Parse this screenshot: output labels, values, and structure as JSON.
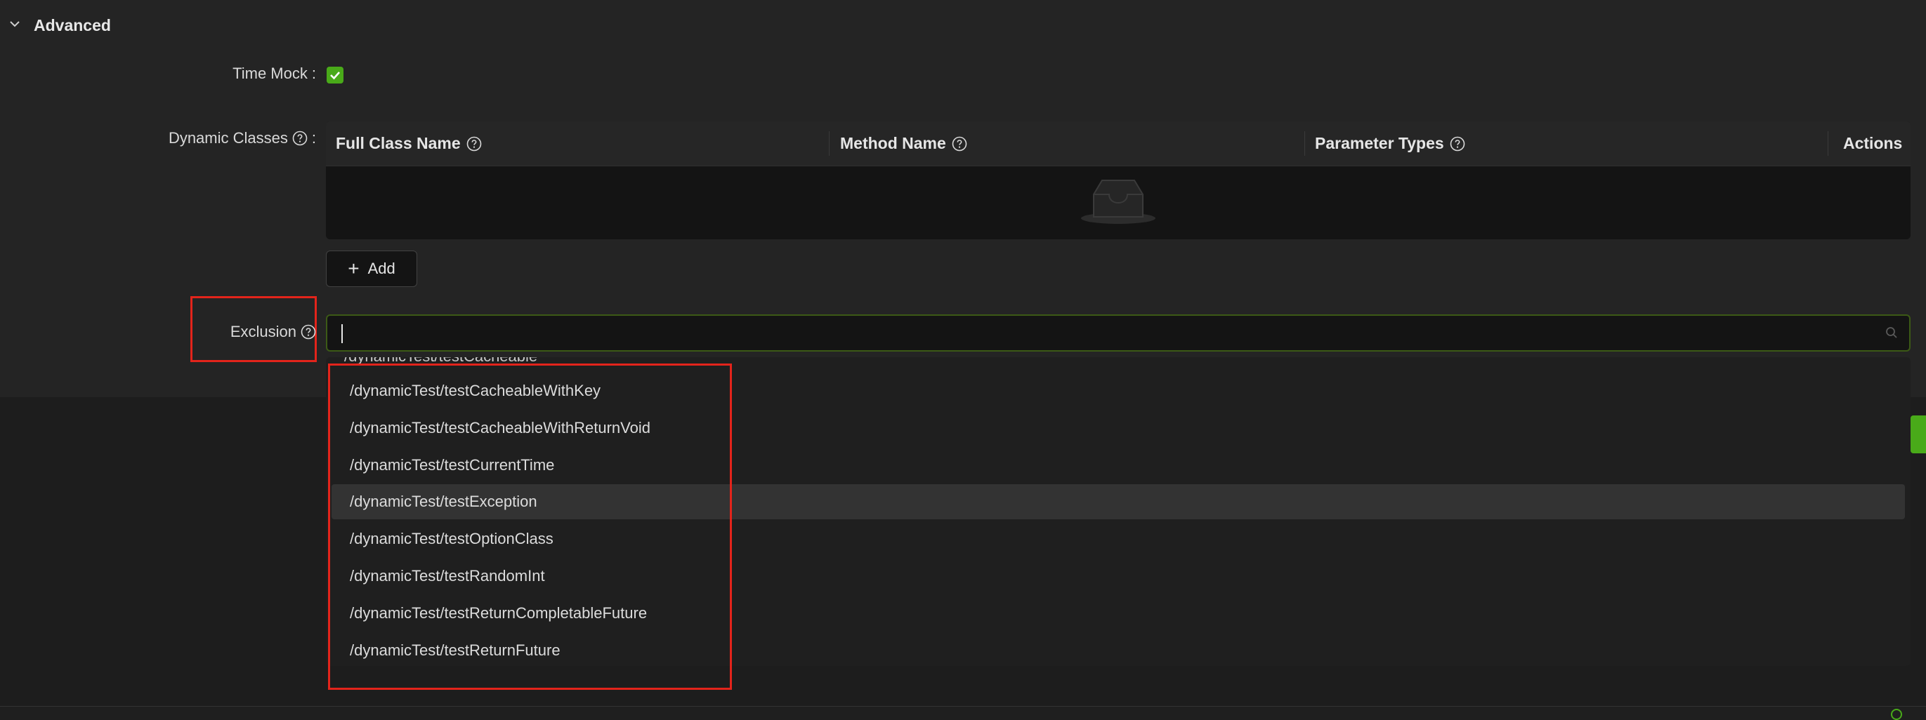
{
  "section": {
    "title": "Advanced"
  },
  "time_mock": {
    "label": "Time Mock",
    "colon": ":",
    "checked": true
  },
  "dynamic_classes": {
    "label": "Dynamic Classes",
    "colon": ":",
    "columns": [
      "Full Class Name",
      "Method Name",
      "Parameter Types",
      "Actions"
    ],
    "rows": [],
    "add_label": "Add"
  },
  "exclusion": {
    "label": "Exclusion",
    "input_value": "",
    "clipped_option": "/dynamicTest/testCacheable",
    "options": [
      "/dynamicTest/testCacheableWithKey",
      "/dynamicTest/testCacheableWithReturnVoid",
      "/dynamicTest/testCurrentTime",
      "/dynamicTest/testException",
      "/dynamicTest/testOptionClass",
      "/dynamicTest/testRandomInt",
      "/dynamicTest/testReturnCompletableFuture",
      "/dynamicTest/testReturnFuture"
    ],
    "active_option_index": 3
  },
  "colors": {
    "accent": "#49aa19",
    "annotation": "#e3241b",
    "panel": "#242424",
    "background": "#1a1a1a"
  },
  "icons": {
    "collapse": "chevron-down-icon",
    "help": "question-circle-icon",
    "check": "check-icon",
    "empty": "empty-inbox-icon",
    "add": "plus-icon",
    "search": "search-icon"
  }
}
